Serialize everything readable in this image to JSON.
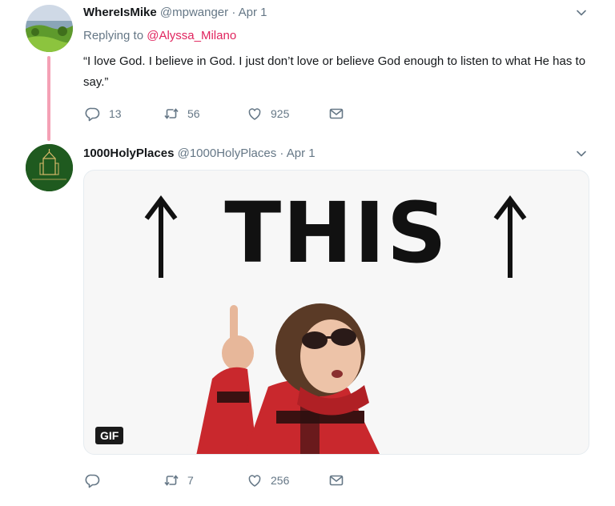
{
  "tweets": [
    {
      "name": "WhereIsMike",
      "handle": "@mpwanger",
      "separator": "·",
      "date": "Apr 1",
      "replying_prefix": "Replying to",
      "replying_to": "@Alyssa_Milano",
      "text": "“I love God. I believe in God. I just don’t  love or believe God enough to listen to what He has to say.”",
      "actions": {
        "reply": "13",
        "retweet": "56",
        "like": "925",
        "dm": ""
      }
    },
    {
      "name": "1000HolyPlaces",
      "handle": "@1000HolyPlaces",
      "separator": "·",
      "date": "Apr 1",
      "media": {
        "caption_text": "THIS",
        "badge": "GIF"
      },
      "actions": {
        "reply": "",
        "retweet": "7",
        "like": "256",
        "dm": ""
      }
    }
  ],
  "colors": {
    "thread_line": "#f4a1b5",
    "mention": "#e0245e",
    "secondary_text": "#657786",
    "primary_text": "#14171a"
  },
  "icons": {
    "reply": "reply-icon",
    "retweet": "retweet-icon",
    "like": "heart-icon",
    "dm": "envelope-icon",
    "more": "chevron-down-icon"
  }
}
